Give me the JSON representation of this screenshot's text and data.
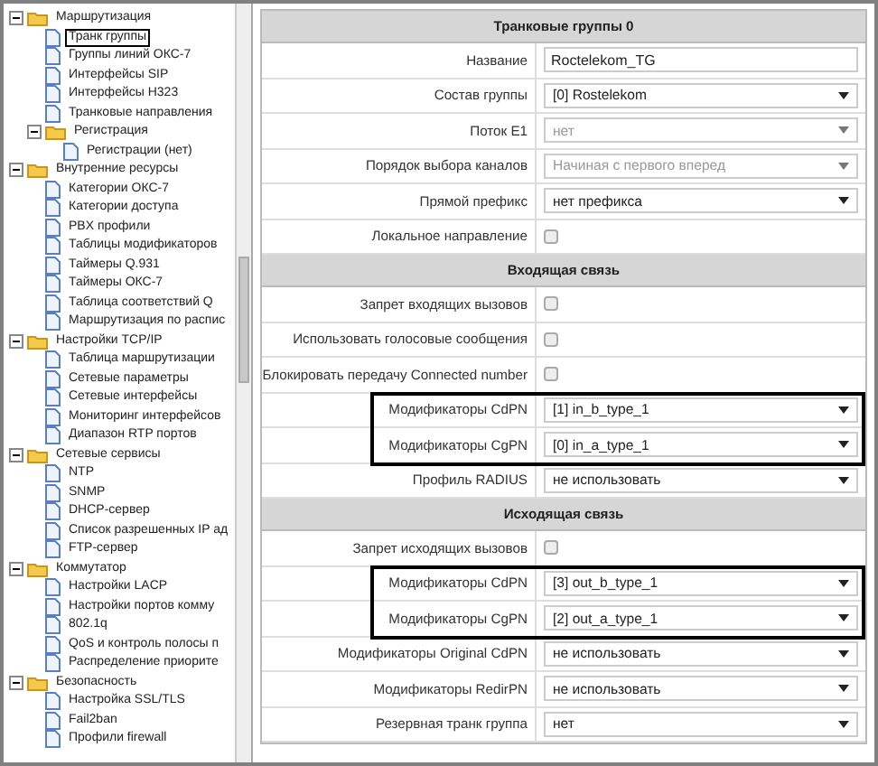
{
  "sidebar": {
    "items": [
      {
        "label": "Маршрутизация",
        "kind": "folder",
        "expanded": true,
        "highlighted": false,
        "children": [
          {
            "label": "Транк группы",
            "kind": "page",
            "highlighted": true
          },
          {
            "label": "Группы линий ОКС-7",
            "kind": "page",
            "highlighted": false
          },
          {
            "label": "Интерфейсы SIP",
            "kind": "page",
            "highlighted": false
          },
          {
            "label": "Интерфейсы H323",
            "kind": "page",
            "highlighted": false
          },
          {
            "label": "Транковые направления",
            "kind": "page",
            "highlighted": false
          },
          {
            "label": "Регистрация",
            "kind": "folder",
            "expanded": true,
            "highlighted": false,
            "children": [
              {
                "label": "Регистрации (нет)",
                "kind": "page",
                "highlighted": false
              }
            ]
          }
        ]
      },
      {
        "label": "Внутренние ресурсы",
        "kind": "folder",
        "expanded": true,
        "highlighted": false,
        "children": [
          {
            "label": "Категории ОКС-7",
            "kind": "page",
            "highlighted": false
          },
          {
            "label": "Категории доступа",
            "kind": "page",
            "highlighted": false
          },
          {
            "label": "PBX профили",
            "kind": "page",
            "highlighted": false
          },
          {
            "label": "Таблицы модификаторов",
            "kind": "page",
            "highlighted": false
          },
          {
            "label": "Таймеры Q.931",
            "kind": "page",
            "highlighted": false
          },
          {
            "label": "Таймеры ОКС-7",
            "kind": "page",
            "highlighted": false
          },
          {
            "label": "Таблица соответствий Q",
            "kind": "page",
            "highlighted": false
          },
          {
            "label": "Маршрутизация по распис",
            "kind": "page",
            "highlighted": false
          }
        ]
      },
      {
        "label": "Настройки TCP/IP",
        "kind": "folder",
        "expanded": true,
        "highlighted": false,
        "children": [
          {
            "label": "Таблица маршрутизации",
            "kind": "page",
            "highlighted": false
          },
          {
            "label": "Сетевые параметры",
            "kind": "page",
            "highlighted": false
          },
          {
            "label": "Сетевые интерфейсы",
            "kind": "page",
            "highlighted": false
          },
          {
            "label": "Мониторинг интерфейсов",
            "kind": "page",
            "highlighted": false
          },
          {
            "label": "Диапазон RTP портов",
            "kind": "page",
            "highlighted": false
          }
        ]
      },
      {
        "label": "Сетевые сервисы",
        "kind": "folder",
        "expanded": true,
        "highlighted": false,
        "children": [
          {
            "label": "NTP",
            "kind": "page",
            "highlighted": false
          },
          {
            "label": "SNMP",
            "kind": "page",
            "highlighted": false
          },
          {
            "label": "DHCP-сервер",
            "kind": "page",
            "highlighted": false
          },
          {
            "label": "Список разрешенных IP ад",
            "kind": "page",
            "highlighted": false
          },
          {
            "label": "FTP-сервер",
            "kind": "page",
            "highlighted": false
          }
        ]
      },
      {
        "label": "Коммутатор",
        "kind": "folder",
        "expanded": true,
        "highlighted": false,
        "children": [
          {
            "label": "Настройки LACP",
            "kind": "page",
            "highlighted": false
          },
          {
            "label": "Настройки портов комму",
            "kind": "page",
            "highlighted": false
          },
          {
            "label": "802.1q",
            "kind": "page",
            "highlighted": false
          },
          {
            "label": "QoS и контроль полосы п",
            "kind": "page",
            "highlighted": false
          },
          {
            "label": "Распределение приорите",
            "kind": "page",
            "highlighted": false
          }
        ]
      },
      {
        "label": "Безопасность",
        "kind": "folder",
        "expanded": true,
        "highlighted": false,
        "children": [
          {
            "label": "Настройка SSL/TLS",
            "kind": "page",
            "highlighted": false
          },
          {
            "label": "Fail2ban",
            "kind": "page",
            "highlighted": false
          },
          {
            "label": "Профили firewall",
            "kind": "page",
            "highlighted": false
          }
        ]
      }
    ]
  },
  "form": {
    "sections": [
      {
        "title": "Транковые группы 0",
        "rows": [
          {
            "label": "Название",
            "kind": "text",
            "value": "Roctelekom_TG",
            "highlighted": false
          },
          {
            "label": "Состав группы",
            "kind": "select",
            "value": "[0] Rostelekom",
            "disabled": false,
            "highlighted": false
          },
          {
            "label": "Поток E1",
            "kind": "select",
            "value": "нет",
            "disabled": true,
            "highlighted": false
          },
          {
            "label": "Порядок выбора каналов",
            "kind": "select",
            "value": "Начиная с первого вперед",
            "disabled": true,
            "highlighted": false
          },
          {
            "label": "Прямой префикс",
            "kind": "select",
            "value": "нет префикса",
            "disabled": false,
            "highlighted": false
          },
          {
            "label": "Локальное направление",
            "kind": "checkbox",
            "checked": false,
            "highlighted": false
          }
        ]
      },
      {
        "title": "Входящая связь",
        "rows": [
          {
            "label": "Запрет входящих вызовов",
            "kind": "checkbox",
            "checked": false,
            "highlighted": false
          },
          {
            "label": "Использовать голосовые сообщения",
            "kind": "checkbox",
            "checked": false,
            "highlighted": false
          },
          {
            "label": "Блокировать передачу Connected number",
            "kind": "checkbox",
            "checked": false,
            "highlighted": false
          },
          {
            "label": "Модификаторы CdPN",
            "kind": "select",
            "value": "[1] in_b_type_1",
            "disabled": false,
            "highlighted": true
          },
          {
            "label": "Модификаторы CgPN",
            "kind": "select",
            "value": "[0] in_a_type_1",
            "disabled": false,
            "highlighted": true
          },
          {
            "label": "Профиль RADIUS",
            "kind": "select",
            "value": "не использовать",
            "disabled": false,
            "highlighted": false
          }
        ]
      },
      {
        "title": "Исходящая связь",
        "rows": [
          {
            "label": "Запрет исходящих вызовов",
            "kind": "checkbox",
            "checked": false,
            "highlighted": false
          },
          {
            "label": "Модификаторы CdPN",
            "kind": "select",
            "value": "[3] out_b_type_1",
            "disabled": false,
            "highlighted": true
          },
          {
            "label": "Модификаторы CgPN",
            "kind": "select",
            "value": "[2] out_a_type_1",
            "disabled": false,
            "highlighted": true
          },
          {
            "label": "Модификаторы Original CdPN",
            "kind": "select",
            "value": "не использовать",
            "disabled": false,
            "highlighted": false
          },
          {
            "label": "Модификаторы RedirPN",
            "kind": "select",
            "value": "не использовать",
            "disabled": false,
            "highlighted": false
          },
          {
            "label": "Резервная транк группа",
            "kind": "select",
            "value": "нет",
            "disabled": false,
            "highlighted": false
          }
        ]
      }
    ]
  }
}
